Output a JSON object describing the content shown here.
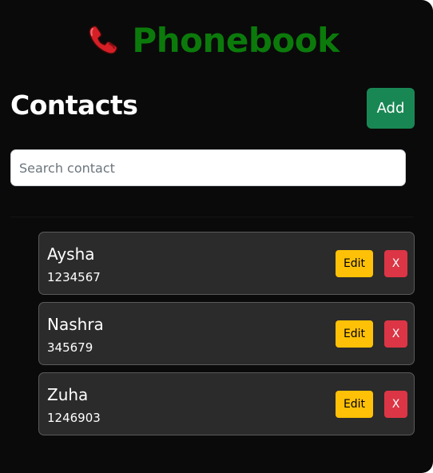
{
  "header": {
    "icon": "telephone-receiver-icon",
    "title": "Phonebook",
    "title_color": "#0b7a0b"
  },
  "contacts_section": {
    "heading": "Contacts",
    "add_label": "Add",
    "add_color": "#198754"
  },
  "search": {
    "placeholder": "Search contact",
    "value": ""
  },
  "contacts": [
    {
      "name": "Aysha",
      "number": "1234567",
      "edit_label": "Edit",
      "delete_label": "X"
    },
    {
      "name": "Nashra",
      "number": "345679",
      "edit_label": "Edit",
      "delete_label": "X"
    },
    {
      "name": "Zuha",
      "number": "1246903",
      "edit_label": "Edit",
      "delete_label": "X"
    }
  ],
  "colors": {
    "background": "#0a0a0a",
    "card": "#2b2b2b",
    "edit": "#ffc107",
    "delete": "#dc3545"
  }
}
